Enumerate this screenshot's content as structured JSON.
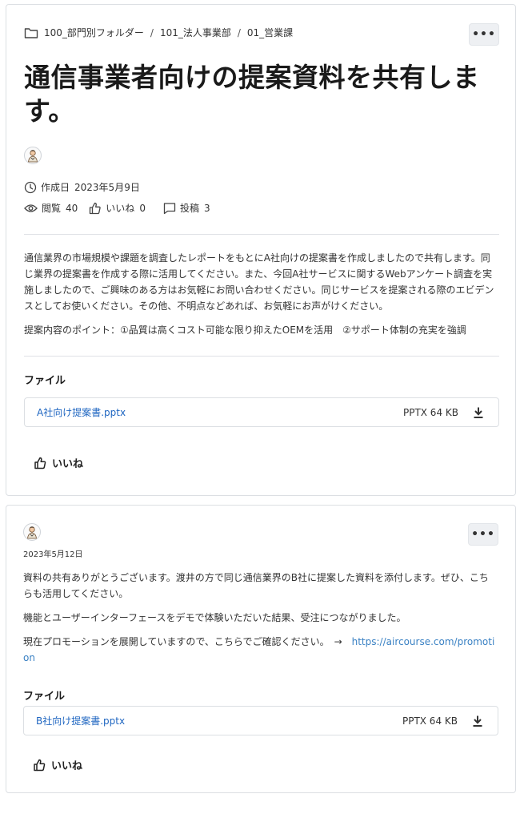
{
  "breadcrumb": {
    "items": [
      "100_部門別フォルダー",
      "101_法人事業部",
      "01_営業課"
    ],
    "separator": "/"
  },
  "more_button": {
    "label": "•••"
  },
  "post": {
    "title": "通信事業者向けの提案資料を共有します。",
    "created_label": "作成日",
    "created_date": "2023年5月9日",
    "views_label": "閲覧",
    "views": "40",
    "likes_label": "いいね",
    "likes": "0",
    "comments_label": "投稿",
    "comments": "3",
    "body": [
      "通信業界の市場規模や課題を調査したレポートをもとにA社向けの提案書を作成しましたので共有します。同じ業界の提案書を作成する際に活用してください。また、今回A社サービスに関するWebアンケート調査を実施しましたので、ご興味のある方はお気軽にお問い合わせください。同じサービスを提案される際のエビデンスとしてお使いください。その他、不明点などあれば、お気軽にお声がけください。",
      "提案内容のポイント：①品質は高くコスト可能な限り抑えたOEMを活用　②サポート体制の充実を強調"
    ],
    "files_label": "ファイル",
    "file": {
      "name": "A社向け提案書.pptx",
      "meta": "PPTX 64 KB"
    },
    "like_button": "いいね"
  },
  "reply": {
    "date": "2023年5月12日",
    "body": [
      "資料の共有ありがとうございます。渡井の方で同じ通信業界のB社に提案した資料を添付します。ぜひ、こちらも活用してください。",
      "機能とユーザーインターフェースをデモで体験いただいた結果、受注につながりました。"
    ],
    "promo_text": "現在プロモーションを展開していますので、こちらでご確認ください。　→　",
    "promo_link": "https://aircourse.com/promotion",
    "files_label": "ファイル",
    "file": {
      "name": "B社向け提案書.pptx",
      "meta": "PPTX 64 KB"
    },
    "like_button": "いいね"
  },
  "icons": {
    "folder": "folder-icon",
    "clock": "clock-icon",
    "eye": "eye-icon",
    "thumbs_up": "thumbs-up-icon",
    "comment": "comment-icon",
    "download": "download-icon",
    "avatar": "avatar-icon"
  },
  "colors": {
    "link": "#1f66c1",
    "border": "#dcdfe3",
    "button_bg": "#eef0f3"
  }
}
